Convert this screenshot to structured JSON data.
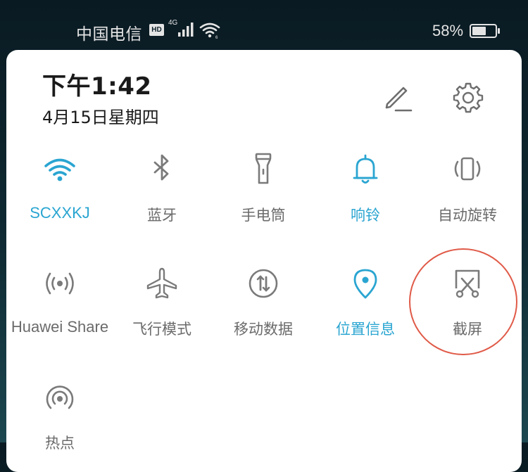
{
  "status_bar": {
    "carrier": "中国电信",
    "hd_badge": "HD",
    "network_type": "4G",
    "battery_percent": "58%"
  },
  "header": {
    "time": "下午1:42",
    "date": "4月15日星期四",
    "edit_icon": "pencil-edit-icon",
    "settings_icon": "gear-icon"
  },
  "colors": {
    "accent_on": "#2aa5d1",
    "icon_off": "#7a7a7a",
    "label_off": "#6b6b6b",
    "annotation": "#e05a48"
  },
  "tiles": [
    {
      "label": "SCXXKJ",
      "icon": "wifi-icon",
      "active": true
    },
    {
      "label": "蓝牙",
      "icon": "bluetooth-icon",
      "active": false
    },
    {
      "label": "手电筒",
      "icon": "flashlight-icon",
      "active": false
    },
    {
      "label": "响铃",
      "icon": "bell-icon",
      "active": true
    },
    {
      "label": "自动旋转",
      "icon": "auto-rotate-icon",
      "active": false
    },
    {
      "label": "Huawei Share",
      "icon": "huawei-share-icon",
      "active": false
    },
    {
      "label": "飞行模式",
      "icon": "airplane-icon",
      "active": false
    },
    {
      "label": "移动数据",
      "icon": "mobile-data-icon",
      "active": false
    },
    {
      "label": "位置信息",
      "icon": "location-pin-icon",
      "active": true
    },
    {
      "label": "截屏",
      "icon": "screenshot-scissors-icon",
      "active": false
    },
    {
      "label": "热点",
      "icon": "hotspot-icon",
      "active": false
    }
  ]
}
